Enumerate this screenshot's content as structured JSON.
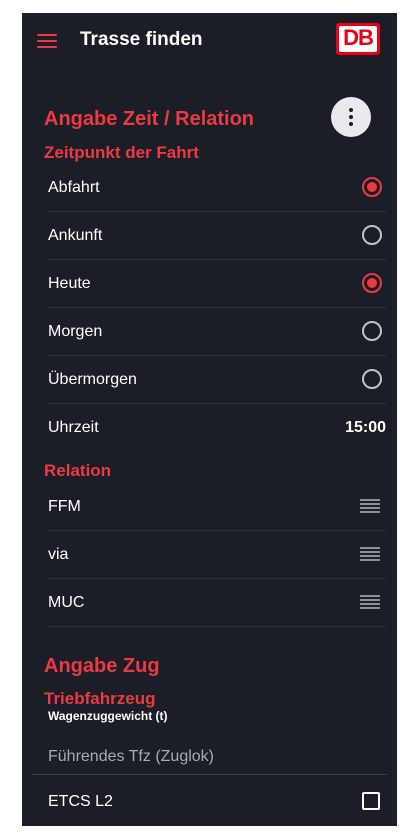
{
  "appbar": {
    "title": "Trasse finden",
    "logo_text": "DB"
  },
  "section_time": {
    "title": "Angabe Zeit / Relation",
    "subtitle": "Zeitpunkt der Fahrt",
    "items": [
      {
        "label": "Abfahrt",
        "selected": true
      },
      {
        "label": "Ankunft",
        "selected": false
      },
      {
        "label": "Heute",
        "selected": true
      },
      {
        "label": "Morgen",
        "selected": false
      },
      {
        "label": "Übermorgen",
        "selected": false
      }
    ],
    "time_label": "Uhrzeit",
    "time_value": "15:00"
  },
  "relation": {
    "title": "Relation",
    "items": [
      {
        "label": "FFM"
      },
      {
        "label": "via"
      },
      {
        "label": "MUC"
      }
    ]
  },
  "section_train": {
    "title": "Angabe Zug",
    "subtitle": "Triebfahrzeug",
    "weight_label": "Wagenzuggewicht (t)",
    "lead_placeholder": "Führendes Tfz (Zuglok)",
    "etcs_label": "ETCS L2",
    "etcs_checked": false
  },
  "colors": {
    "accent": "#ec3a43",
    "background": "#1b1e26",
    "text": "#ffffff"
  }
}
